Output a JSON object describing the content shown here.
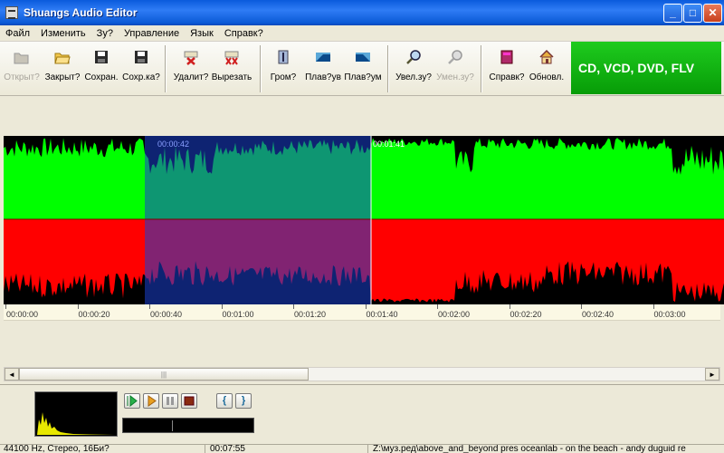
{
  "window": {
    "title": "Shuangs Audio Editor",
    "minimize": "_",
    "maximize": "□",
    "close": "✕"
  },
  "menu": [
    "Файл",
    "Изменить",
    "Зу?",
    "Управление",
    "Язык",
    "Справк?"
  ],
  "toolbar": [
    {
      "label": "Открыт?",
      "icon": "open-folder-icon",
      "enabled": false
    },
    {
      "label": "Закрыт?",
      "icon": "close-folder-icon",
      "enabled": true
    },
    {
      "label": "Сохран.",
      "icon": "save-disk-icon",
      "enabled": true
    },
    {
      "label": "Сохр.ка?",
      "icon": "save-as-disk-icon",
      "enabled": true
    },
    {
      "label": "Удалит?",
      "icon": "delete-icon",
      "enabled": true
    },
    {
      "label": "Вырезать",
      "icon": "cut-icon",
      "enabled": true
    },
    {
      "label": "Гром?",
      "icon": "volume-icon",
      "enabled": true
    },
    {
      "label": "Плав?ув",
      "icon": "fade-in-icon",
      "enabled": true
    },
    {
      "label": "Плав?ум",
      "icon": "fade-out-icon",
      "enabled": true
    },
    {
      "label": "Увел.зу?",
      "icon": "zoom-in-icon",
      "enabled": true
    },
    {
      "label": "Умен.зу?",
      "icon": "zoom-out-icon",
      "enabled": false
    },
    {
      "label": "Справк?",
      "icon": "help-book-icon",
      "enabled": true
    },
    {
      "label": "Обновл.",
      "icon": "home-icon",
      "enabled": true
    }
  ],
  "promo": "CD, VCD, DVD, FLV",
  "waveform": {
    "selection_start_label": "00:00:42",
    "cursor_label": "00:01:41",
    "colors": {
      "left_channel": "#00ff00",
      "right_channel": "#ff0000",
      "selection": "#1a3fd0",
      "background": "#000000"
    }
  },
  "timeline": [
    "00:00:00",
    "00:00:20",
    "00:00:40",
    "00:01:00",
    "00:01:20",
    "00:01:40",
    "00:02:00",
    "00:02:20",
    "00:02:40",
    "00:03:00"
  ],
  "scrollbar": {
    "left_arrow": "◄",
    "right_arrow": "►",
    "grip": "|||"
  },
  "player": {
    "play": "play-icon",
    "play_selection": "play-selection-icon",
    "pause": "pause-icon",
    "stop": "stop-icon",
    "mark_start": "{",
    "mark_end": "}"
  },
  "status": {
    "format": "44100 Hz, Стерео, 16Би?",
    "duration": "00:07:55",
    "path": "Z:\\муз.ред\\above_and_beyond pres oceanlab - on the beach - andy duguid re"
  }
}
